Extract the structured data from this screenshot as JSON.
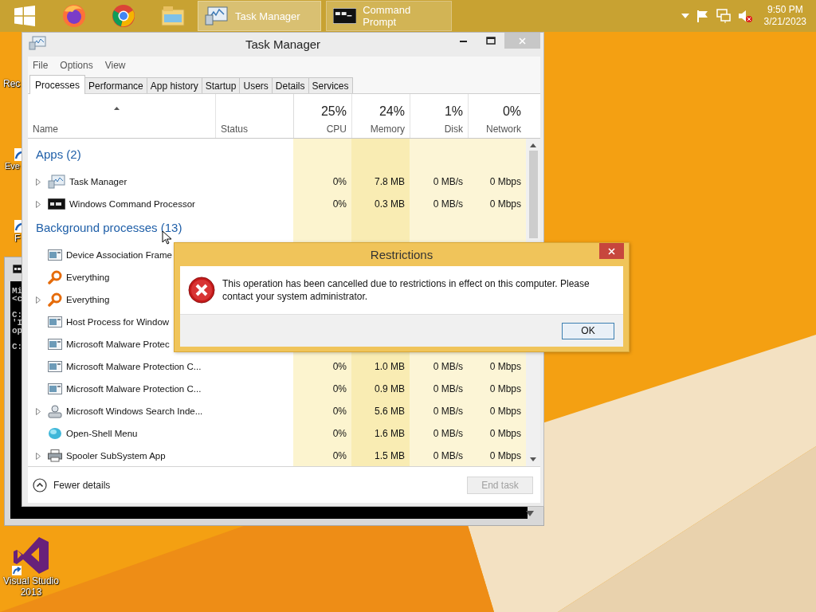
{
  "taskbar": {
    "pinned": [
      {
        "kind": "start"
      },
      {
        "kind": "firefox"
      },
      {
        "kind": "chrome"
      },
      {
        "kind": "explorer"
      }
    ],
    "windows": [
      {
        "label": "Task Manager",
        "kind": "taskmgr",
        "selected": true
      },
      {
        "label": "Command Prompt",
        "kind": "cmd",
        "selected": false
      }
    ],
    "tray": [
      {
        "kind": "caret"
      },
      {
        "kind": "flag"
      },
      {
        "kind": "network"
      },
      {
        "kind": "volume-muted"
      }
    ],
    "clock": {
      "time": "9:50 PM",
      "date": "3/21/2023"
    }
  },
  "desktop_icons": [
    {
      "label": "Rec",
      "kind": "none"
    },
    {
      "label": "Eve",
      "kind": "shortcut"
    },
    {
      "label": "F",
      "kind": "shortcut"
    },
    {
      "label": "Visual Studio 2013",
      "kind": "vs"
    }
  ],
  "console_window": {
    "lines": [
      "Mi",
      "<c",
      "C:",
      "'I",
      "op",
      "C:"
    ]
  },
  "task_manager": {
    "title": "Task Manager",
    "menu": [
      "File",
      "Options",
      "View"
    ],
    "tabs": [
      {
        "label": "Processes",
        "selected": true
      },
      {
        "label": "Performance",
        "selected": false
      },
      {
        "label": "App history",
        "selected": false
      },
      {
        "label": "Startup",
        "selected": false
      },
      {
        "label": "Users",
        "selected": false
      },
      {
        "label": "Details",
        "selected": false
      },
      {
        "label": "Services",
        "selected": false
      }
    ],
    "columns": [
      {
        "label": "Name"
      },
      {
        "label": "Status"
      },
      {
        "percent": "25%",
        "label": "CPU"
      },
      {
        "percent": "24%",
        "label": "Memory"
      },
      {
        "percent": "1%",
        "label": "Disk"
      },
      {
        "percent": "0%",
        "label": "Network"
      }
    ],
    "groups": [
      {
        "title": "Apps (2)",
        "rows": [
          {
            "name": "Task Manager",
            "expandable": true,
            "kind": "taskmgr",
            "cpu": "0%",
            "memory": "7.8 MB",
            "disk": "0 MB/s",
            "network": "0 Mbps"
          },
          {
            "name": "Windows Command Processor",
            "expandable": true,
            "kind": "cmd",
            "cpu": "0%",
            "memory": "0.3 MB",
            "disk": "0 MB/s",
            "network": "0 Mbps"
          }
        ]
      },
      {
        "title": "Background processes (13)",
        "rows": [
          {
            "name": "Device Association Frame",
            "expandable": false,
            "kind": "window"
          },
          {
            "name": "Everything",
            "expandable": false,
            "kind": "search"
          },
          {
            "name": "Everything",
            "expandable": true,
            "kind": "search"
          },
          {
            "name": "Host Process for Window",
            "expandable": false,
            "kind": "window"
          },
          {
            "name": "Microsoft Malware Protec",
            "expandable": false,
            "kind": "window"
          },
          {
            "name": "Microsoft Malware Protection C...",
            "expandable": false,
            "kind": "window",
            "cpu": "0%",
            "memory": "1.0 MB",
            "disk": "0 MB/s",
            "network": "0 Mbps"
          },
          {
            "name": "Microsoft Malware Protection C...",
            "expandable": false,
            "kind": "window",
            "cpu": "0%",
            "memory": "0.9 MB",
            "disk": "0 MB/s",
            "network": "0 Mbps"
          },
          {
            "name": "Microsoft Windows Search Inde...",
            "expandable": true,
            "kind": "user",
            "cpu": "0%",
            "memory": "5.6 MB",
            "disk": "0 MB/s",
            "network": "0 Mbps"
          },
          {
            "name": "Open-Shell Menu",
            "expandable": false,
            "kind": "shell",
            "cpu": "0%",
            "memory": "1.6 MB",
            "disk": "0 MB/s",
            "network": "0 Mbps"
          },
          {
            "name": "Spooler SubSystem App",
            "expandable": true,
            "kind": "printer",
            "cpu": "0%",
            "memory": "1.5 MB",
            "disk": "0 MB/s",
            "network": "0 Mbps"
          }
        ]
      }
    ],
    "footer": {
      "toggle": "Fewer details",
      "end_task": {
        "label": "End task",
        "disabled": true
      }
    }
  },
  "dialog": {
    "title": "Restrictions",
    "message": "This operation has been cancelled due to restrictions in effect on this computer. Please contact your system administrator.",
    "buttons": [
      {
        "label": "OK",
        "focused": true
      }
    ]
  }
}
